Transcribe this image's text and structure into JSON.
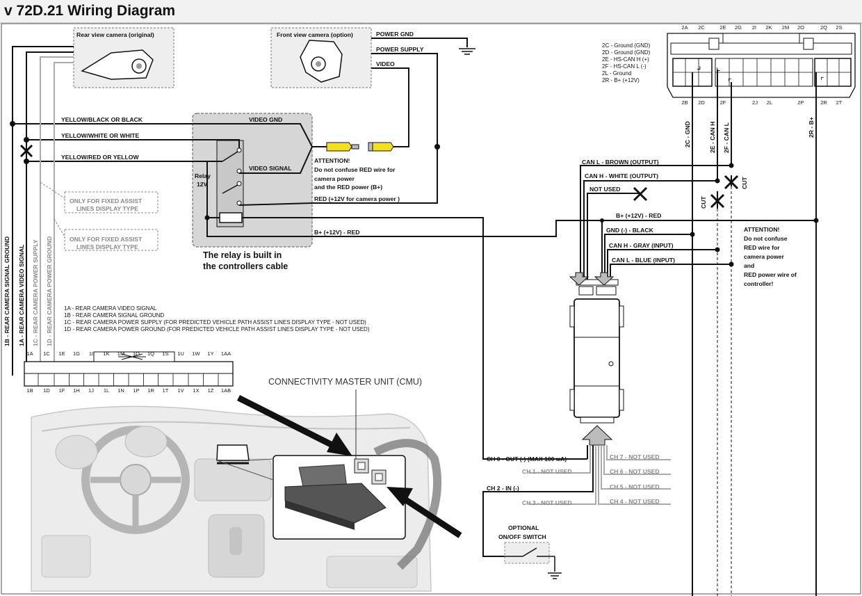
{
  "title": "v 72D.21 Wiring Diagram",
  "cameras": {
    "rear": "Rear view camera (original)",
    "front": "Front view camera (option)"
  },
  "front_wires": {
    "power_gnd": "POWER GND",
    "power_supply": "POWER SUPPLY",
    "video": "VIDEO"
  },
  "rear_wires": {
    "yellow_black": "YELLOW/BLACK OR BLACK",
    "yellow_white": "YELLOW/WHITE OR WHITE",
    "yellow_red": "YELLOW/RED OR YELLOW"
  },
  "relay": {
    "video_gnd": "VIDEO GND",
    "video_signal": "VIDEO SIGNAL",
    "relay_label_1": "Relay",
    "relay_label_2": "12V",
    "note_1": "The relay is built in",
    "note_2": "the controllers cable",
    "attention": [
      "ATTENTION!",
      "Do not confuse  RED wire for",
      "camera power",
      "and the RED power (B+)"
    ],
    "red_camera_power": "RED (+12V for camera power )",
    "bplus_red": "B+ (+12V) - RED"
  },
  "fixed_assist": [
    "ONLY FOR FIXED ASSIST",
    "LINES DISPLAY TYPE"
  ],
  "vertical_labels": {
    "1b": "1B - REAR CAMERA SIGNAL GROUND",
    "1a": "1A - REAR CAMERA VIDEO SIGNAL",
    "1c": "1C - REAR CAMERA POWER SUPPLY",
    "1d": "1D - REAR CAMERA POWER GROUND"
  },
  "pin_legend": [
    "1A - REAR CAMERA VIDEO SIGNAL",
    "1B - REAR CAMERA SIGNAL GROUND",
    "1C - REAR CAMERA POWER SUPPLY (FOR PREDICTED VEHICLE PATH ASSIST LINES DISPLAY TYPE - NOT USED)",
    "1D - REAR CAMERA POWER GROUND (FOR PREDICTED VEHICLE PATH ASSIST LINES DISPLAY TYPE - NOT USED)"
  ],
  "connector1": {
    "top": [
      "1A",
      "1C",
      "1E",
      "1G",
      "1I",
      "1K",
      "1M",
      "1O",
      "1Q",
      "1S",
      "1U",
      "1W",
      "1Y",
      "1AA"
    ],
    "bottom": [
      "1B",
      "1D",
      "1F",
      "1H",
      "1J",
      "1L",
      "1N",
      "1P",
      "1R",
      "1T",
      "1V",
      "1X",
      "1Z",
      "1AB"
    ]
  },
  "cmu_label": "CONNECTIVITY MASTER UNIT (CMU)",
  "connector2": {
    "top": [
      "2A",
      "2C",
      "2E",
      "2G",
      "2I",
      "2K",
      "2M",
      "2O",
      "2Q",
      "2S"
    ],
    "bottom": [
      "2B",
      "2D",
      "2F",
      "2J",
      "2L",
      "2P",
      "2R",
      "2T"
    ],
    "legend": [
      "2C - Ground (GND)",
      "2D - Ground (GND)",
      "2E - HS-CAN H (+)",
      "2F - HS-CAN L (-)",
      "2L - Ground",
      "2R - B+ (+12V)"
    ],
    "vertical": [
      "2C - GND",
      "2E - CAN H",
      "2F - CAN L",
      "2R - B+"
    ]
  },
  "controller_wires": {
    "can_l_out": "CAN L - BROWN (OUTPUT)",
    "can_h_out": "CAN H - WHITE (OUTPUT)",
    "not_used": "NOT USED",
    "bplus": "B+ (+12V) - RED",
    "gnd": "GND (-) - BLACK",
    "can_h_in": "CAN H - GRAY (INPUT)",
    "can_l_in": "CAN L - BLUE (INPUT)",
    "cut": "CUT"
  },
  "attention2": [
    "ATTENTION!",
    "Do not confuse",
    "RED wire for",
    "camera power",
    "and",
    "RED power wire of",
    "controller!"
  ],
  "channels": {
    "ch0": "CH 0 - OUT (-) (MAX 100 мА)",
    "ch1": "CH 1 - NOT USED",
    "ch2": "CH 2 - IN (-)",
    "ch3": "CH 3 - NOT USED",
    "ch4": "CH 4 - NOT USED",
    "ch5": "CH 5 - NOT USED",
    "ch6": "CH 6 - NOT USED",
    "ch7": "CH 7 - NOT USED"
  },
  "switch": [
    "OPTIONAL",
    "ON/OFF SWITCH"
  ]
}
